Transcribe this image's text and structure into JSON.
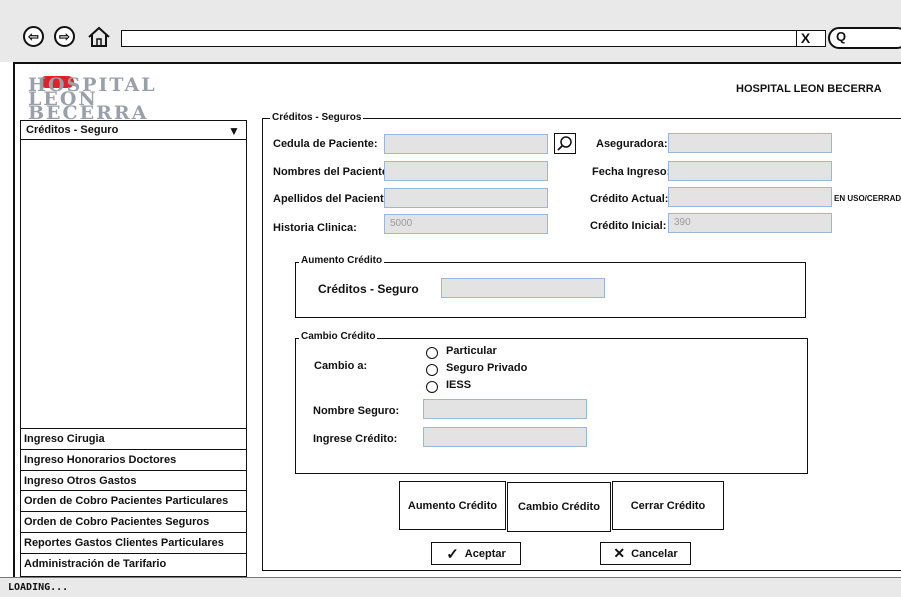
{
  "browser": {
    "url": "",
    "search_glyph": "Q",
    "back_glyph": "⇦",
    "forward_glyph": "⇨",
    "close_glyph": "X"
  },
  "logo": {
    "line1": "HOSPITAL",
    "line2": "LEON",
    "line3": "BECERRA"
  },
  "header": {
    "hospital_name": "HOSPITAL LEON BECERRA"
  },
  "sidebar": {
    "dropdown_label": "Créditos - Seguro",
    "items": [
      {
        "label": "Ingreso Cirugia"
      },
      {
        "label": "Ingreso Honorarios Doctores"
      },
      {
        "label": "Ingreso Otros Gastos"
      },
      {
        "label": "Orden de Cobro Pacientes Particulares"
      },
      {
        "label": "Orden de Cobro Pacientes Seguros"
      },
      {
        "label": "Reportes Gastos Clientes Particulares"
      },
      {
        "label": "Administración de Tarifario"
      }
    ]
  },
  "form": {
    "group_title": "Créditos - Seguros",
    "cedula_label": "Cedula de Paciente:",
    "nombres_label": "Nombres del Paciente:",
    "apellidos_label": "Apellidos del Paciente:",
    "historia_label": "Historia Clinica:",
    "historia_value": "5000",
    "aseguradora_label": "Aseguradora:",
    "fecha_label": "Fecha Ingreso:",
    "credito_actual_label": "Crédito Actual:",
    "credito_actual_status": "EN USO/CERRADO",
    "credito_inicial_label": "Crédito Inicial:",
    "credito_inicial_value": "390"
  },
  "aumento": {
    "title": "Aumento Crédito",
    "label": "Créditos - Seguro"
  },
  "cambio": {
    "title": "Cambio Crédito",
    "cambio_label": "Cambio a:",
    "options": [
      "Particular",
      "Seguro Privado",
      "IESS"
    ],
    "nombre_seguro_label": "Nombre Seguro:",
    "ingrese_credito_label": "Ingrese Crédito:"
  },
  "actions": {
    "aumento": "Aumento Crédito",
    "cambio": "Cambio Crédito",
    "cerrar": "Cerrar Crédito",
    "aceptar": "Aceptar",
    "cancelar": "Cancelar"
  },
  "status": {
    "text": "LOADING..."
  }
}
